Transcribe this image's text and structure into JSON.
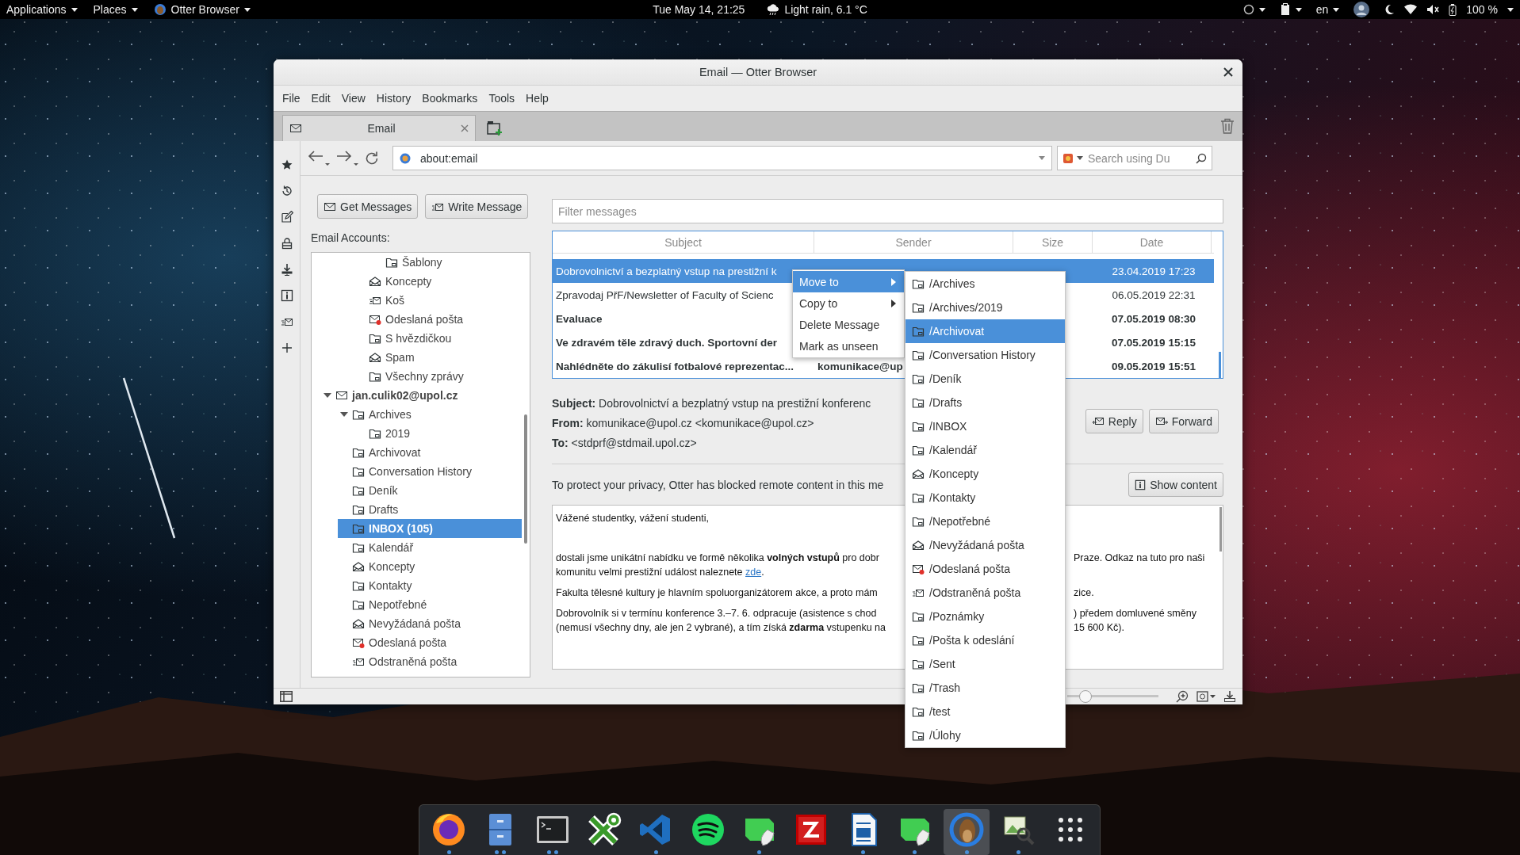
{
  "top_panel": {
    "menus": [
      {
        "label": "Applications",
        "kind": "plain"
      },
      {
        "label": "Places",
        "kind": "plain"
      },
      {
        "label": "Otter Browser",
        "kind": "app"
      }
    ],
    "clock": "Tue May 14, 21:25",
    "weather": "Light rain, 6.1 °C",
    "language": "en",
    "battery": "100 %"
  },
  "window": {
    "title": "Email — Otter Browser"
  },
  "menu_bar": [
    "File",
    "Edit",
    "View",
    "History",
    "Bookmarks",
    "Tools",
    "Help"
  ],
  "tabs": [
    {
      "label": "Email",
      "selected": true
    }
  ],
  "address_bar": {
    "url": "about:email",
    "search_placeholder": "Search using Du"
  },
  "toolbar": [
    {
      "label": "Get Messages",
      "kind": "get"
    },
    {
      "label": "Write Message",
      "kind": "write"
    }
  ],
  "filter": {
    "placeholder": "Filter messages"
  },
  "accounts_label": "Email Accounts:",
  "tree": [
    {
      "children": [
        {
          "children": [
            {
              "children": [
                {
                  "label": "Šablony",
                  "kind": "folder",
                  "selected": false
                }
              ]
            },
            {
              "label": "Koncepty",
              "kind": "drafts",
              "selected": false
            },
            {
              "label": "Koš",
              "kind": "trash",
              "selected": false
            },
            {
              "label": "Odeslaná pošta",
              "kind": "sent",
              "selected": false
            },
            {
              "label": "S hvězdičkou",
              "kind": "folder",
              "selected": false
            },
            {
              "label": "Spam",
              "kind": "drafts",
              "selected": false
            },
            {
              "label": "Všechny zprávy",
              "kind": "folder",
              "selected": false
            }
          ]
        }
      ]
    },
    {
      "label": "jan.culik02@upol.cz",
      "kind": "account",
      "expanded": true,
      "selected": false,
      "children": [
        {
          "label": "Archives",
          "kind": "folder",
          "expanded": true,
          "selected": false,
          "children": [
            {
              "label": "2019",
              "kind": "folder",
              "selected": false
            }
          ]
        },
        {
          "label": "Archivovat",
          "kind": "folder",
          "selected": false
        },
        {
          "label": "Conversation History",
          "kind": "folder",
          "selected": false
        },
        {
          "label": "Deník",
          "kind": "folder",
          "selected": false
        },
        {
          "label": "Drafts",
          "kind": "folder",
          "selected": false
        },
        {
          "label": "INBOX (105)",
          "kind": "folder",
          "selected": true
        },
        {
          "label": "Kalendář",
          "kind": "folder",
          "selected": false
        },
        {
          "label": "Koncepty",
          "kind": "drafts",
          "selected": false
        },
        {
          "label": "Kontakty",
          "kind": "folder",
          "selected": false
        },
        {
          "label": "Nepotřebné",
          "kind": "folder",
          "selected": false
        },
        {
          "label": "Nevyžádaná pošta",
          "kind": "drafts",
          "selected": false
        },
        {
          "label": "Odeslaná pošta",
          "kind": "sent",
          "selected": false
        },
        {
          "label": "Odstraněná pošta",
          "kind": "trash",
          "selected": false
        }
      ]
    }
  ],
  "messages": {
    "columns": [
      "Subject",
      "Sender",
      "Size",
      "Date"
    ],
    "rows": [
      {
        "subject": "Dobrovolnictví a bezplatný vstup na prestižní k",
        "date": "23.04.2019 17:23",
        "unread": false,
        "selected": true
      },
      {
        "subject": "Zpravodaj PřF/Newsletter of Faculty of Scienc",
        "date": "06.05.2019 22:31",
        "unread": false,
        "selected": false
      },
      {
        "subject": "Evaluace",
        "date": "07.05.2019 08:30",
        "unread": true,
        "selected": false
      },
      {
        "subject": "Ve zdravém těle zdravý duch. Sportovní der",
        "date": "07.05.2019 15:15",
        "unread": true,
        "selected": false
      },
      {
        "subject": "Nahlédněte do zákulisí fotbalové reprezentac...",
        "sender": "komunikace@up",
        "date": "09.05.2019 15:51",
        "unread": true,
        "selected": false
      }
    ]
  },
  "header": {
    "lines": [
      "**Subject:** Dobrovolnictví a bezplatný vstup na prestižní konferenc",
      "**From:** komunikace@upol.cz <komunikace@upol.cz>",
      "**To:** <stdprf@stdmail.upol.cz>"
    ],
    "buttons": [
      {
        "label": "Reply",
        "kind": "reply"
      },
      {
        "label": "Forward",
        "kind": "forward"
      }
    ]
  },
  "privacy": {
    "text": "To protect your privacy, Otter has blocked remote content in this me",
    "button": "Show content"
  },
  "body": {
    "paragraphs": [
      {
        "lines": [
          {
            "left": "Vážené studentky, vážení studenti,"
          }
        ]
      },
      {
        "lines": [
          {
            "left": "dostali jsme unikátní nabídku ve formě několika **volných vstupů** pro dobr",
            "right": "Praze. Odkaz na tuto pro naši"
          },
          {
            "left": "komunitu velmi prestižní událost naleznete ",
            "link": "zde",
            "after": "."
          }
        ]
      },
      {
        "lines": [
          {
            "left": "Fakulta tělesné kultury je hlavním spoluorganizátorem akce, a proto mám",
            "right": "zice."
          }
        ]
      },
      {
        "lines": [
          {
            "left": "Dobrovolník si v termínu konference 3.–7. 6. odpracuje (asistence s chod",
            "right": ") předem domluvené směny"
          },
          {
            "left": "(nemusí všechny dny, ale jen 2 vybrané), a tím získá **zdarma** vstupenku na",
            "right": "15 600 Kč)."
          }
        ]
      }
    ]
  },
  "zoom": {
    "level": 0.2
  },
  "context_menu": {
    "items": [
      {
        "label": "Move to",
        "submenu": true,
        "selected": true
      },
      {
        "label": "Copy to",
        "submenu": true,
        "selected": false
      },
      {
        "label": "Delete Message",
        "submenu": false,
        "selected": false
      },
      {
        "label": "Mark as unseen",
        "submenu": false,
        "selected": false
      }
    ],
    "submenu": [
      {
        "label": "/Archives",
        "kind": "folder",
        "selected": false
      },
      {
        "label": "/Archives/2019",
        "kind": "folder",
        "selected": false
      },
      {
        "label": "/Archivovat",
        "kind": "folder",
        "selected": true
      },
      {
        "label": "/Conversation History",
        "kind": "folder",
        "selected": false
      },
      {
        "label": "/Deník",
        "kind": "folder",
        "selected": false
      },
      {
        "label": "/Drafts",
        "kind": "folder",
        "selected": false
      },
      {
        "label": "/INBOX",
        "kind": "folder",
        "selected": false
      },
      {
        "label": "/Kalendář",
        "kind": "folder",
        "selected": false
      },
      {
        "label": "/Koncepty",
        "kind": "drafts",
        "selected": false
      },
      {
        "label": "/Kontakty",
        "kind": "folder",
        "selected": false
      },
      {
        "label": "/Nepotřebné",
        "kind": "folder",
        "selected": false
      },
      {
        "label": "/Nevyžádaná pošta",
        "kind": "drafts",
        "selected": false
      },
      {
        "label": "/Odeslaná pošta",
        "kind": "sent",
        "selected": false
      },
      {
        "label": "/Odstraněná pošta",
        "kind": "trash",
        "selected": false
      },
      {
        "label": "/Poznámky",
        "kind": "folder",
        "selected": false
      },
      {
        "label": "/Pošta k odeslání",
        "kind": "folder",
        "selected": false
      },
      {
        "label": "/Sent",
        "kind": "folder",
        "selected": false
      },
      {
        "label": "/Trash",
        "kind": "folder",
        "selected": false
      },
      {
        "label": "/test",
        "kind": "folder",
        "selected": false
      },
      {
        "label": "/Úlohy",
        "kind": "folder",
        "selected": false
      }
    ]
  },
  "dock": {
    "items": [
      {
        "kind": "globe",
        "running": true,
        "multiple": false,
        "selected": false
      },
      {
        "kind": "cabinet",
        "running": true,
        "multiple": true,
        "selected": false
      },
      {
        "kind": "terminal",
        "running": true,
        "multiple": true,
        "selected": false
      },
      {
        "kind": "crosskey",
        "running": false,
        "selected": false
      },
      {
        "kind": "chevron",
        "running": true,
        "multiple": false,
        "selected": false
      },
      {
        "kind": "waves",
        "running": false,
        "selected": false
      },
      {
        "kind": "tile",
        "running": true,
        "multiple": false,
        "selected": false
      },
      {
        "kind": "zigzag",
        "running": false,
        "selected": false
      },
      {
        "kind": "document",
        "running": true,
        "multiple": false,
        "selected": false
      },
      {
        "kind": "tile",
        "running": true,
        "multiple": false,
        "selected": false
      },
      {
        "kind": "animal",
        "running": true,
        "multiple": false,
        "selected": true
      },
      {
        "kind": "imagesearch",
        "running": true,
        "multiple": false,
        "selected": false
      },
      {
        "kind": "grid",
        "running": false,
        "selected": false
      }
    ]
  }
}
